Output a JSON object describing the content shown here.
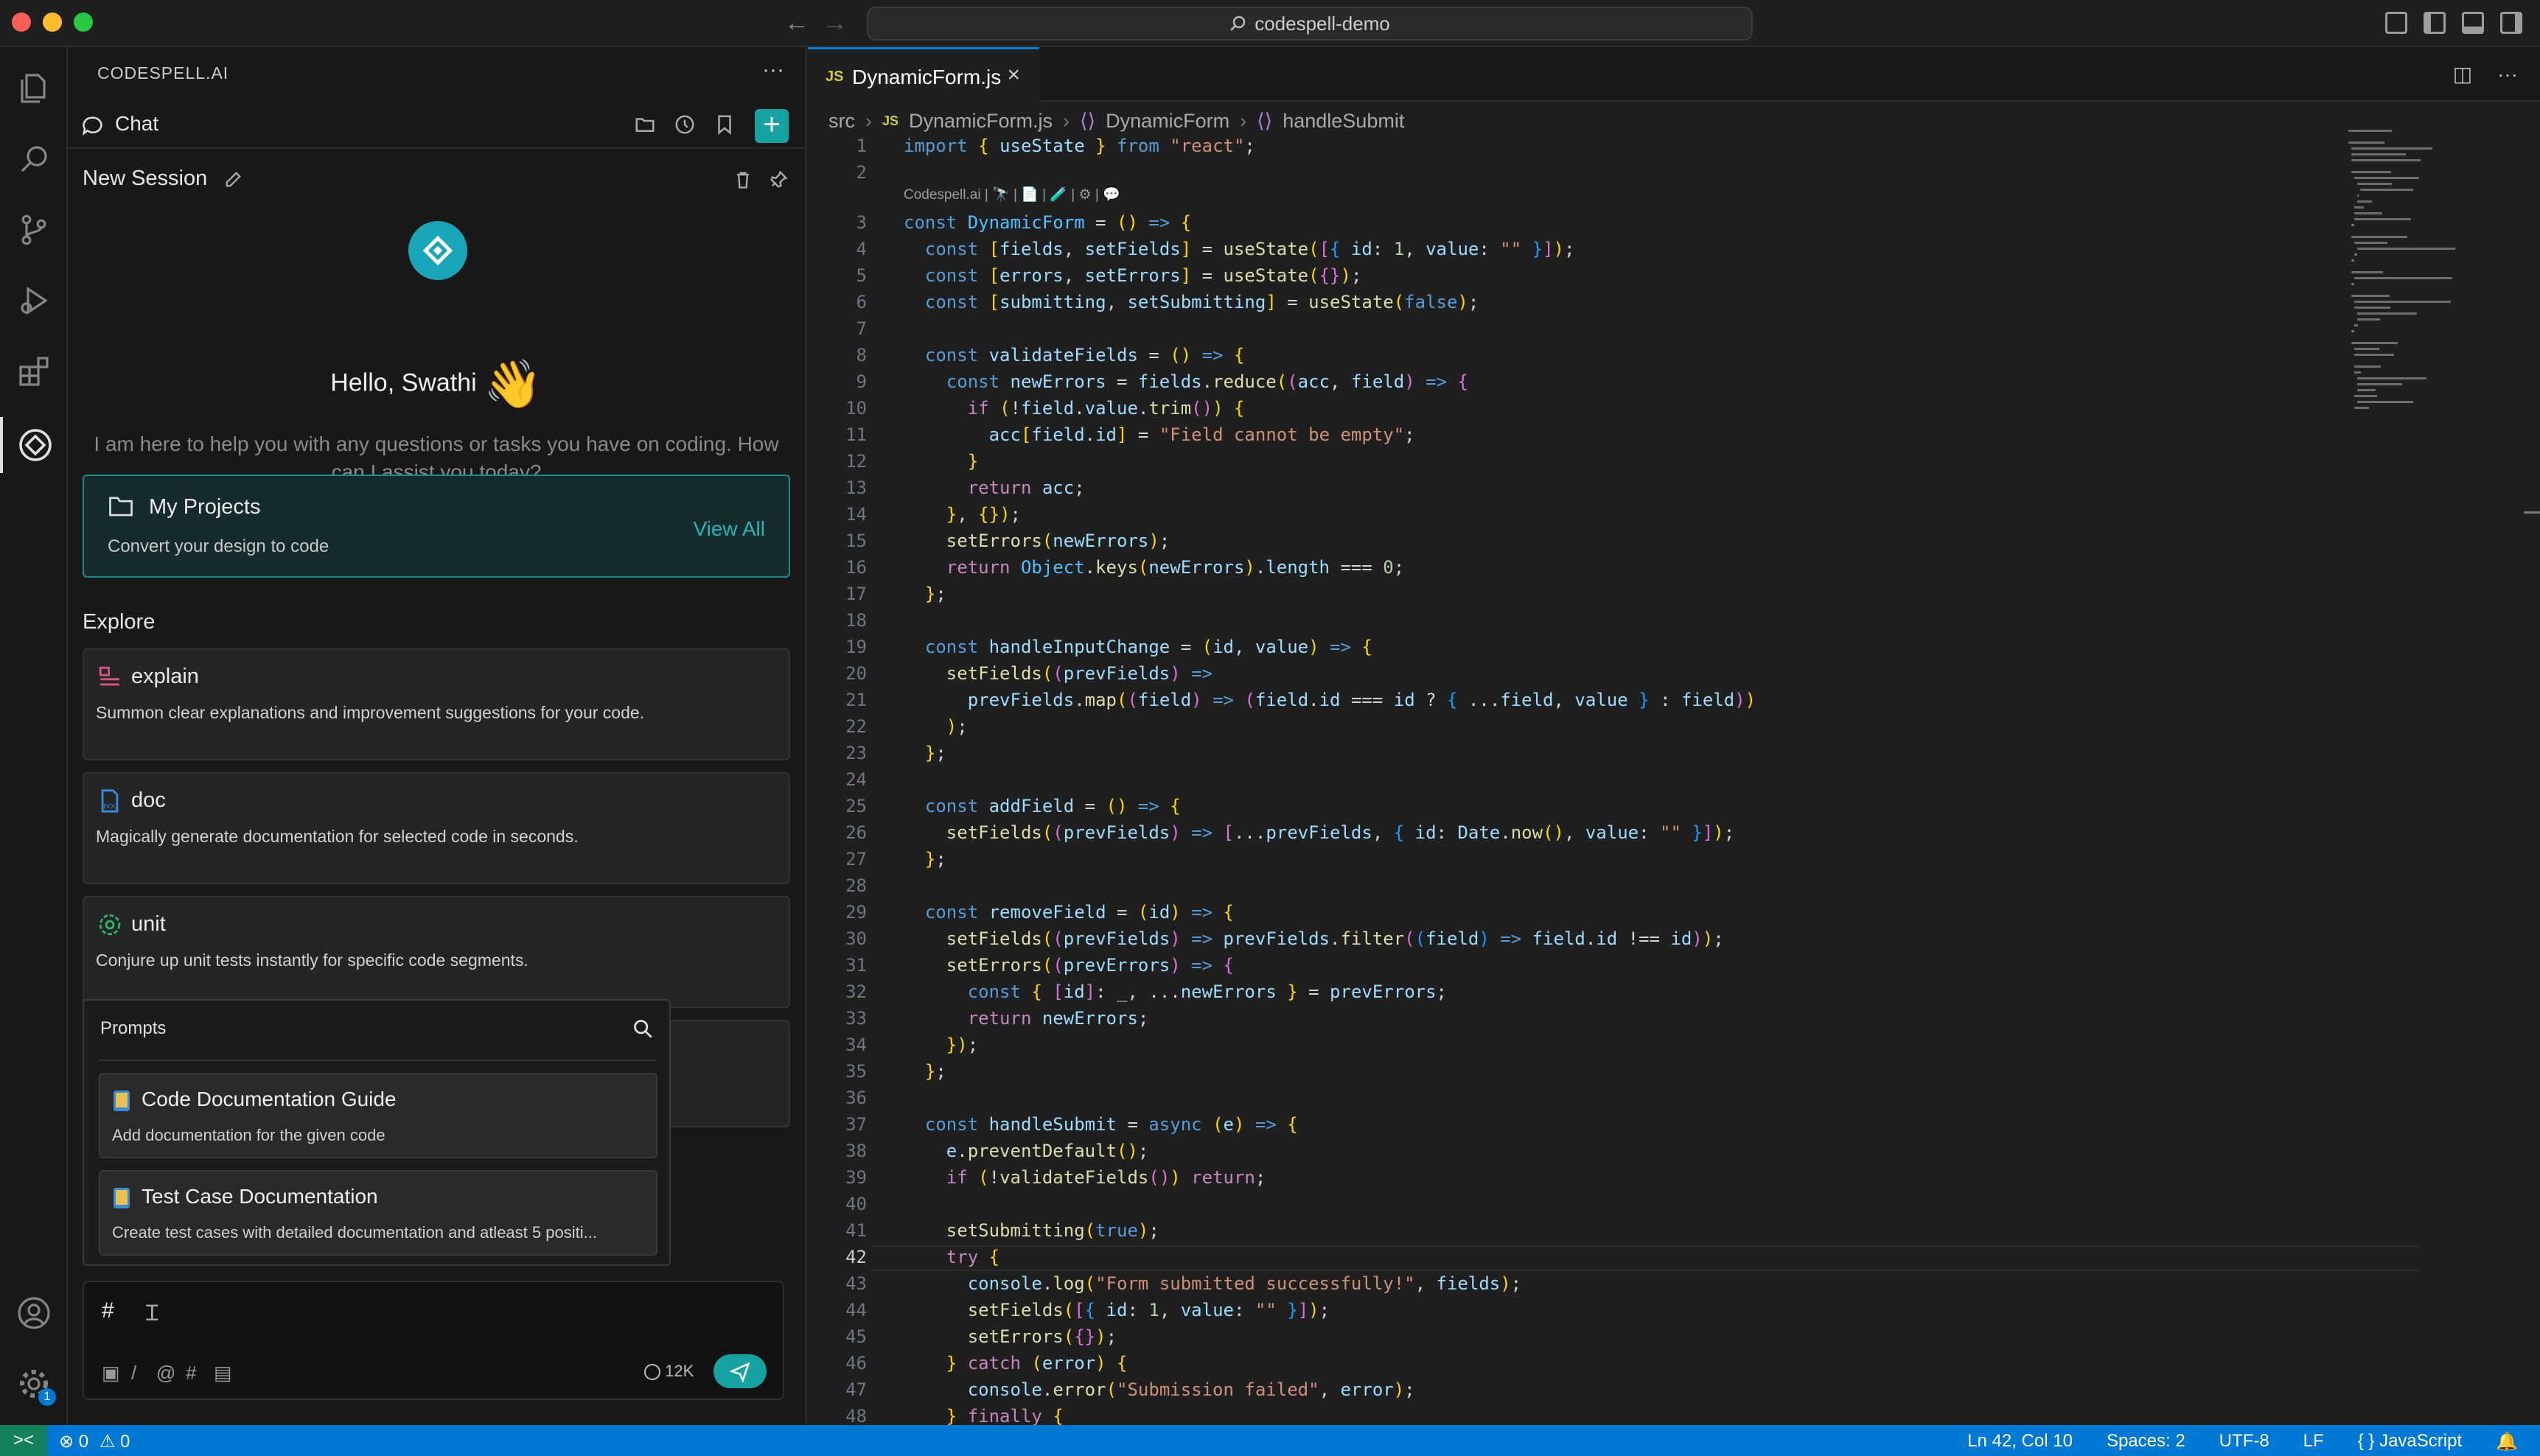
{
  "titlebar": {
    "search": "codespell-demo"
  },
  "sidebar": {
    "header": "CODESPELL.AI",
    "chat_title": "Chat",
    "session_title": "New Session",
    "greeting": "Hello, Swathi",
    "wave": "👋",
    "intro": "I am here to help you with any questions or tasks you have on coding. How can I assist you today?",
    "projects": {
      "title": "My Projects",
      "subtitle": "Convert your design to code",
      "view_all": "View All"
    },
    "explore_title": "Explore",
    "cards": [
      {
        "title": "explain",
        "desc": "Summon clear explanations and improvement suggestions for your code.",
        "icon": "explain-icon"
      },
      {
        "title": "doc",
        "desc": "Magically generate documentation for selected code in seconds.",
        "icon": "doc-icon"
      },
      {
        "title": "unit",
        "desc": "Conjure up unit tests instantly for specific code segments.",
        "icon": "unit-test-icon"
      }
    ],
    "prompts": {
      "title": "Prompts",
      "items": [
        {
          "title": "Code Documentation Guide",
          "desc": "Add documentation for the given code"
        },
        {
          "title": "Test Case Documentation",
          "desc": "Create test cases with detailed documentation and atleast 5 positi..."
        }
      ]
    },
    "input": {
      "value": "#",
      "tokens": "12K"
    }
  },
  "editor": {
    "tab_label": "DynamicForm.js",
    "tab_lang": "JS",
    "breadcrumb": [
      "src",
      "DynamicForm.js",
      "DynamicForm",
      "handleSubmit"
    ],
    "codelens": "Codespell.ai | 🔭 | 📄 | 🧪 | ⚙ | 💬",
    "current_line": 42,
    "lines": [
      "import { useState } from \"react\";",
      "",
      "const DynamicForm = () => {",
      "  const [fields, setFields] = useState([{ id: 1, value: \"\" }]);",
      "  const [errors, setErrors] = useState({});",
      "  const [submitting, setSubmitting] = useState(false);",
      "",
      "  const validateFields = () => {",
      "    const newErrors = fields.reduce((acc, field) => {",
      "      if (!field.value.trim()) {",
      "        acc[field.id] = \"Field cannot be empty\";",
      "      }",
      "      return acc;",
      "    }, {});",
      "    setErrors(newErrors);",
      "    return Object.keys(newErrors).length === 0;",
      "  };",
      "",
      "  const handleInputChange = (id, value) => {",
      "    setFields((prevFields) =>",
      "      prevFields.map((field) => (field.id === id ? { ...field, value } : field))",
      "    );",
      "  };",
      "",
      "  const addField = () => {",
      "    setFields((prevFields) => [...prevFields, { id: Date.now(), value: \"\" }]);",
      "  };",
      "",
      "  const removeField = (id) => {",
      "    setFields((prevFields) => prevFields.filter((field) => field.id !== id));",
      "    setErrors((prevErrors) => {",
      "      const { [id]: _, ...newErrors } = prevErrors;",
      "      return newErrors;",
      "    });",
      "  };",
      "",
      "  const handleSubmit = async (e) => {",
      "    e.preventDefault();",
      "    if (!validateFields()) return;",
      "",
      "    setSubmitting(true);",
      "    try {",
      "      console.log(\"Form submitted successfully!\", fields);",
      "      setFields([{ id: 1, value: \"\" }]);",
      "      setErrors({});",
      "    } catch (error) {",
      "      console.error(\"Submission failed\", error);",
      "    } finally {"
    ]
  },
  "status": {
    "errors": "0",
    "warnings": "0",
    "position": "Ln 42, Col 10",
    "spaces": "Spaces: 2",
    "encoding": "UTF-8",
    "eol": "LF",
    "language": "JavaScript",
    "settings_badge": "1"
  }
}
